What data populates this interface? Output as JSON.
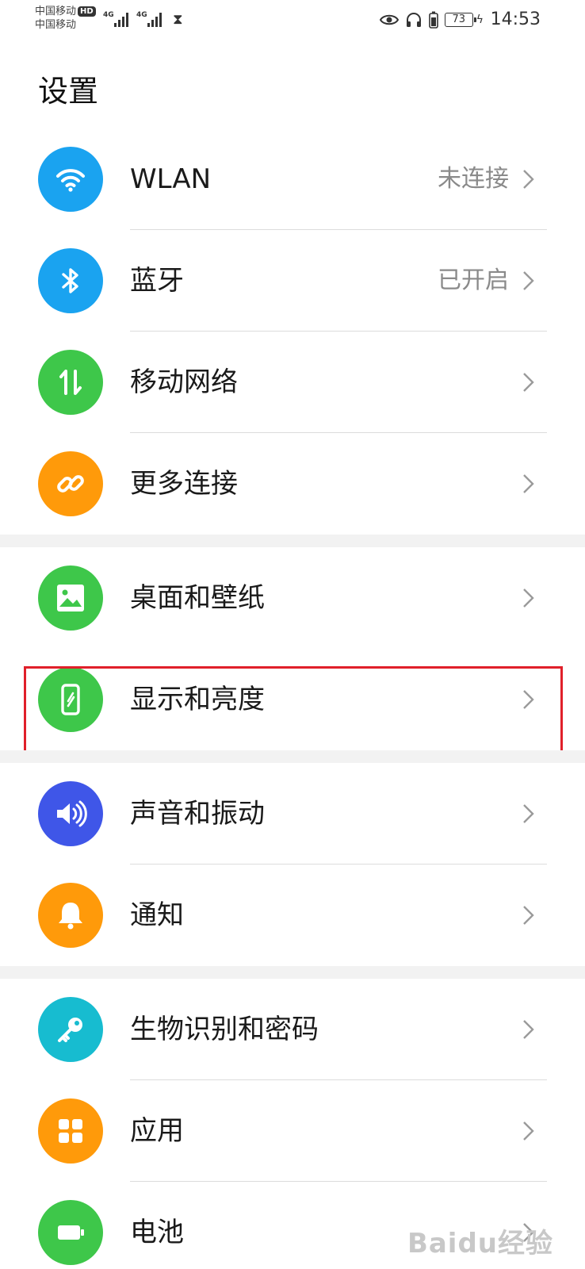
{
  "status_bar": {
    "carrier_1": "中国移动",
    "hd_badge": "HD",
    "carrier_2": "中国移动",
    "network_1": "4G",
    "network_2": "4G",
    "battery_level": "73",
    "time": "14:53"
  },
  "page": {
    "title": "设置"
  },
  "rows": [
    {
      "label": "WLAN",
      "value": "未连接",
      "icon": "wifi-icon",
      "color": "#1aa3f0"
    },
    {
      "label": "蓝牙",
      "value": "已开启",
      "icon": "bluetooth-icon",
      "color": "#1aa3f0"
    },
    {
      "label": "移动网络",
      "value": "",
      "icon": "mobile-data-icon",
      "color": "#3ec74a"
    },
    {
      "label": "更多连接",
      "value": "",
      "icon": "link-icon",
      "color": "#ff9a0a"
    },
    {
      "label": "桌面和壁纸",
      "value": "",
      "icon": "wallpaper-icon",
      "color": "#3ec74a"
    },
    {
      "label": "显示和亮度",
      "value": "",
      "icon": "display-icon",
      "color": "#3ec74a"
    },
    {
      "label": "声音和振动",
      "value": "",
      "icon": "sound-icon",
      "color": "#3f56e8"
    },
    {
      "label": "通知",
      "value": "",
      "icon": "bell-icon",
      "color": "#ff9a0a"
    },
    {
      "label": "生物识别和密码",
      "value": "",
      "icon": "key-icon",
      "color": "#17bcd0"
    },
    {
      "label": "应用",
      "value": "",
      "icon": "apps-icon",
      "color": "#ff9a0a"
    },
    {
      "label": "电池",
      "value": "",
      "icon": "battery-icon",
      "color": "#3ec74a"
    }
  ],
  "watermark": {
    "text": "Baidu经验"
  }
}
